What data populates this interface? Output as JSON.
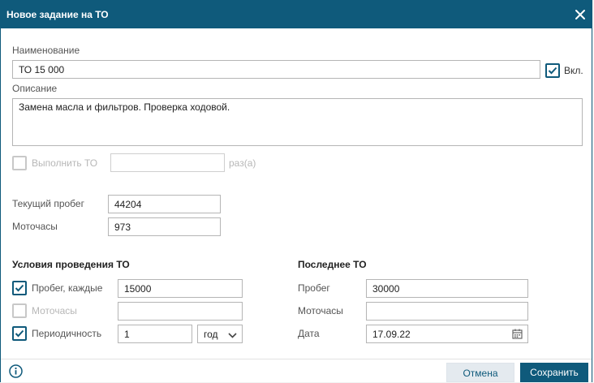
{
  "dialog": {
    "title": "Новое задание на ТО"
  },
  "form": {
    "name_label": "Наименование",
    "name_value": "ТО 15 000",
    "enabled_label": "Вкл.",
    "description_label": "Описание",
    "description_value": "Замена масла и фильтров. Проверка ходовой.",
    "execute_label": "Выполнить ТО",
    "execute_value": "",
    "times_label": "раз(а)",
    "mileage_label": "Текущий пробег",
    "mileage_value": "44204",
    "motohours_label": "Моточасы",
    "motohours_value": "973"
  },
  "conditions": {
    "heading": "Условия проведения ТО",
    "mileage_label": "Пробег, каждые",
    "mileage_value": "15000",
    "motohours_label": "Моточасы",
    "motohours_value": "",
    "period_label": "Периодичность",
    "period_value": "1",
    "period_unit": "год"
  },
  "last": {
    "heading": "Последнее ТО",
    "mileage_label": "Пробег",
    "mileage_value": "30000",
    "motohours_label": "Моточасы",
    "motohours_value": "",
    "date_label": "Дата",
    "date_value": "17.09.22"
  },
  "footer": {
    "cancel_label": "Отмена",
    "save_label": "Сохранить"
  },
  "colors": {
    "primary": "#0f5a7b",
    "cancel_bg": "#e4eaef"
  }
}
